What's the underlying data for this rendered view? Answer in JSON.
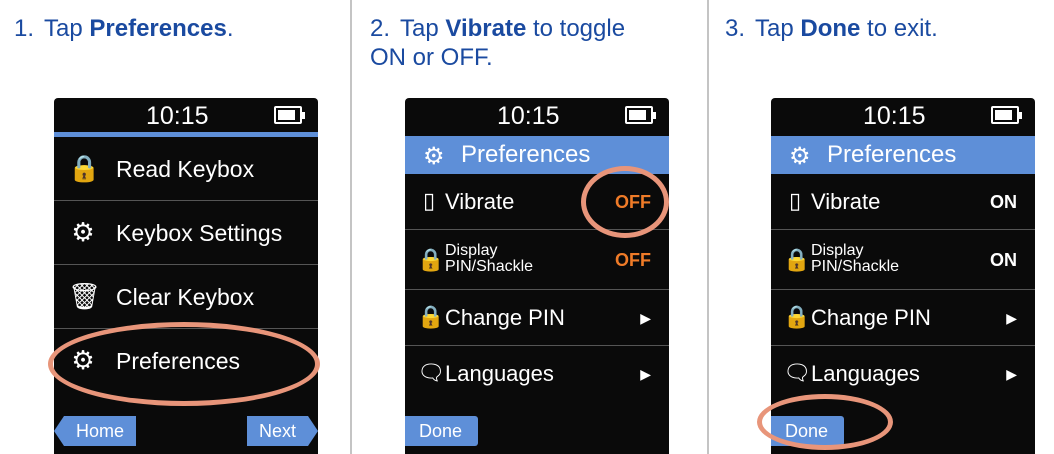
{
  "steps": [
    {
      "num": "1.",
      "pre": "Tap ",
      "em": "Preferences",
      "post": "."
    },
    {
      "num": "2.",
      "pre": "Tap ",
      "em": "Vibrate",
      "post": " to toggle",
      "line2": "ON or OFF."
    },
    {
      "num": "3.",
      "pre": "Tap ",
      "em": "Done",
      "post": " to exit."
    }
  ],
  "status": {
    "time": "10:15"
  },
  "main_menu": {
    "items": [
      {
        "label": "Read Keybox",
        "icon": "read-keybox-icon"
      },
      {
        "label": "Keybox Settings",
        "icon": "keybox-settings-icon"
      },
      {
        "label": "Clear Keybox",
        "icon": "trash-icon"
      },
      {
        "label": "Preferences",
        "icon": "gear-icon"
      }
    ],
    "home": "Home",
    "next": "Next"
  },
  "prefs_screen": {
    "title": "Preferences",
    "vibrate": "Vibrate",
    "display_1": "Display",
    "display_2": "PIN/Shackle",
    "change_pin": "Change PIN",
    "languages": "Languages",
    "done": "Done"
  },
  "screen2": {
    "vibrate_value": "OFF",
    "display_value": "OFF"
  },
  "screen3": {
    "vibrate_value": "ON",
    "display_value": "ON"
  },
  "colors": {
    "step_text": "#1a4aa0",
    "accent": "#5e8fd8",
    "off": "#ef7b28",
    "highlight": "#e8957a"
  }
}
